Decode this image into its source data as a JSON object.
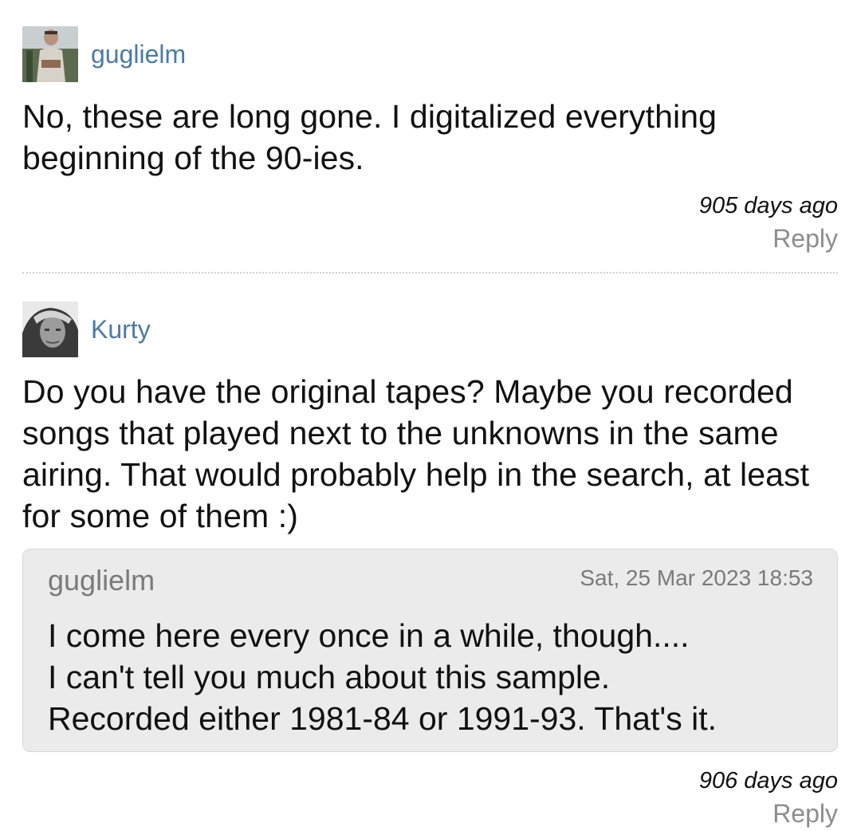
{
  "comments": [
    {
      "username": "guglielm",
      "avatar_icon": "user-avatar-photo",
      "body": "No, these are long gone. I digitalized everything beginning of the 90-ies.",
      "timestamp": "905 days ago",
      "reply_label": "Reply"
    },
    {
      "username": "Kurty",
      "avatar_icon": "user-avatar-photo",
      "body": "Do you have the original tapes? Maybe you recorded songs that played next to the unknowns in the same airing. That would probably help in the search, at least for some of them :)",
      "quote": {
        "author": "guglielm",
        "date": "Sat, 25 Mar 2023 18:53",
        "text": "I come here every once in a while, though....\nI can't tell you much about this sample.\nRecorded either 1981-84 or 1991-93. That's it."
      },
      "timestamp": "906 days ago",
      "reply_label": "Reply"
    }
  ],
  "colors": {
    "username": "#4b7aa6",
    "reply": "#8c8c8c",
    "quote_background": "#ebebeb",
    "quote_muted_text": "#7a7a7a",
    "body_text": "#111111"
  }
}
